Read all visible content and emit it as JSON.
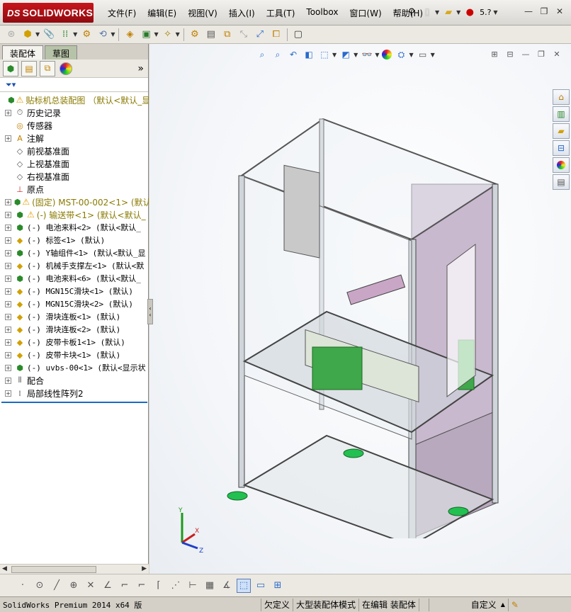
{
  "app": {
    "logo_prefix": "DS",
    "logo_text": "SOLIDWORKS"
  },
  "menu": [
    {
      "label": "文件(F)"
    },
    {
      "label": "编辑(E)"
    },
    {
      "label": "视图(V)"
    },
    {
      "label": "插入(I)"
    },
    {
      "label": "工具(T)"
    },
    {
      "label": "Toolbox"
    },
    {
      "label": "窗口(W)"
    },
    {
      "label": "帮助(H)"
    }
  ],
  "title_tools": {
    "help_label": "5."
  },
  "feature_manager": {
    "tabs": [
      {
        "label": "装配体",
        "active": true
      },
      {
        "label": "草图",
        "active": false
      }
    ],
    "expand_symbol": "»",
    "tree": [
      {
        "label": "贴标机总装配图 （默认<默认_显",
        "icon": "assembly-icon",
        "warn": true,
        "expand": false,
        "kind": "root"
      },
      {
        "label": "历史记录",
        "icon": "history-icon",
        "expand": true
      },
      {
        "label": "传感器",
        "icon": "sensor-icon",
        "expand": false
      },
      {
        "label": "注解",
        "icon": "annotation-icon",
        "expand": true
      },
      {
        "label": "前视基准面",
        "icon": "plane-icon",
        "expand": false
      },
      {
        "label": "上视基准面",
        "icon": "plane-icon",
        "expand": false
      },
      {
        "label": "右视基准面",
        "icon": "plane-icon",
        "expand": false
      },
      {
        "label": "原点",
        "icon": "origin-icon",
        "expand": false
      },
      {
        "label": "(固定) MST-00-002<1> (默认",
        "icon": "subassembly-icon",
        "warn": true,
        "expand": true,
        "kind": "warnc"
      },
      {
        "label": "(-) 输送带<1> (默认<默认_",
        "icon": "subassembly-icon",
        "warn": true,
        "expand": true,
        "kind": "warnc"
      },
      {
        "label": "(-) 电池来料<2> (默认<默认_",
        "icon": "subassembly-icon",
        "expand": true,
        "kind": "comp"
      },
      {
        "label": "(-) 标签<1> (默认)",
        "icon": "part-icon",
        "expand": true,
        "kind": "comp"
      },
      {
        "label": "(-) Y轴组件<1> (默认<默认_显",
        "icon": "subassembly-icon",
        "expand": true,
        "kind": "comp"
      },
      {
        "label": "(-) 机械手支撑左<1> (默认<默",
        "icon": "part-icon",
        "expand": true,
        "kind": "comp"
      },
      {
        "label": "(-) 电池来料<6> (默认<默认_",
        "icon": "subassembly-icon",
        "expand": true,
        "kind": "comp"
      },
      {
        "label": "(-) MGN15C滑块<1> (默认)",
        "icon": "part-icon",
        "expand": true,
        "kind": "comp"
      },
      {
        "label": "(-) MGN15C滑块<2> (默认)",
        "icon": "part-icon",
        "expand": true,
        "kind": "comp"
      },
      {
        "label": "(-) 滑块连板<1> (默认)",
        "icon": "part-icon",
        "expand": true,
        "kind": "comp"
      },
      {
        "label": "(-) 滑块连板<2> (默认)",
        "icon": "part-icon",
        "expand": true,
        "kind": "comp"
      },
      {
        "label": "(-) 皮带卡板1<1> (默认)",
        "icon": "part-icon",
        "expand": true,
        "kind": "comp"
      },
      {
        "label": "(-) 皮带卡块<1> (默认)",
        "icon": "part-icon",
        "expand": true,
        "kind": "comp"
      },
      {
        "label": "(-) uvbs-00<1> (默认<显示状",
        "icon": "subassembly-icon",
        "expand": true,
        "kind": "comp"
      },
      {
        "label": "配合",
        "icon": "mates-icon",
        "expand": true
      },
      {
        "label": "局部线性阵列2",
        "icon": "pattern-icon",
        "expand": true
      }
    ]
  },
  "status": {
    "product": "SolidWorks Premium 2014 x64 版",
    "underdefined": "欠定义",
    "mode": "大型装配体模式",
    "editing": "在编辑 装配体",
    "units": "自定义"
  },
  "triad": {
    "x": "X",
    "y": "Y",
    "z": "Z"
  },
  "colors": {
    "logo_red": "#b3121a",
    "frame_green": "#22c050",
    "panel_purple": "#c9b9cf",
    "warning": "#e0a000"
  }
}
